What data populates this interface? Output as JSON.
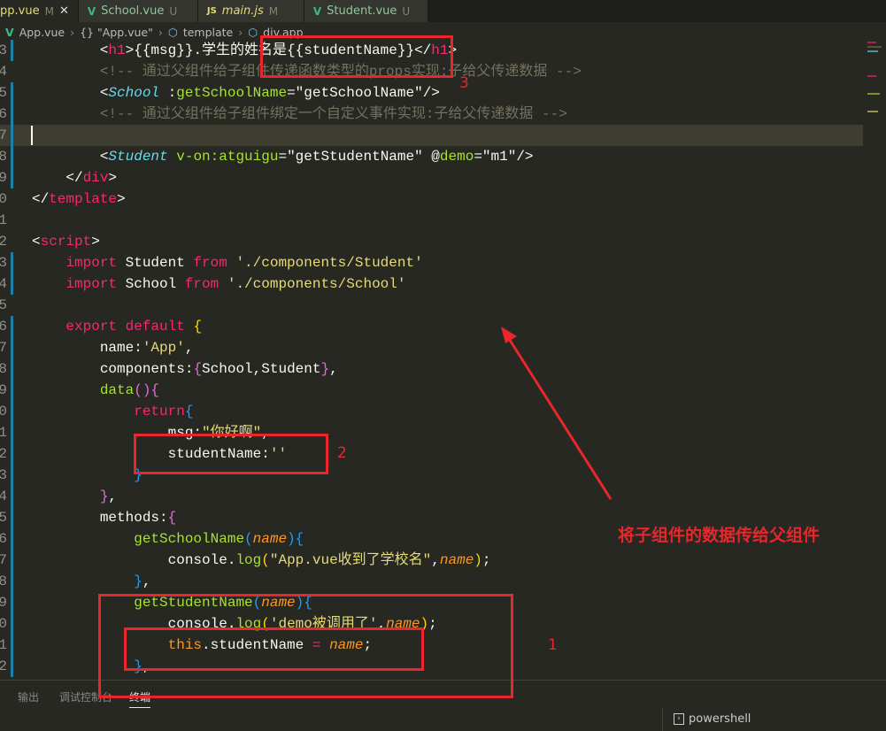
{
  "tabs": [
    {
      "label": "pp.vue",
      "status": "M",
      "icon": "vue-icon",
      "active": true
    },
    {
      "label": "School.vue",
      "status": "U",
      "icon": "vue-icon"
    },
    {
      "label": "main.js",
      "status": "M",
      "icon": "js-icon"
    },
    {
      "label": "Student.vue",
      "status": "U",
      "icon": "vue-icon"
    }
  ],
  "breadcrumb": [
    "App.vue",
    "{} \"App.vue\"",
    "template",
    "div.app"
  ],
  "code": [
    {
      "n": "3",
      "m": true,
      "t": [
        [
          "        ",
          "pun"
        ],
        [
          "<",
          "pun"
        ],
        [
          "h1",
          "tag"
        ],
        [
          ">{{msg}}.学生的姓名是{{studentName}}</",
          "pun"
        ],
        [
          "h1",
          "tag"
        ],
        [
          ">",
          "pun"
        ]
      ]
    },
    {
      "n": "4",
      "t": [
        [
          "        <!-- 通过父组件给子组件传递函数类型的props实现:子给父传递数据 -->",
          "cmt"
        ]
      ]
    },
    {
      "n": "5",
      "m": true,
      "t": [
        [
          "        <",
          "pun"
        ],
        [
          "School",
          "cmp"
        ],
        [
          " :",
          "pun"
        ],
        [
          "getSchoolName",
          "attr"
        ],
        [
          "=\"getSchoolName\"/>",
          "pun"
        ]
      ]
    },
    {
      "n": "6",
      "m": true,
      "t": [
        [
          "        <!-- 通过父组件给子组件绑定一个自定义事件实现:子给父传递数据 -->",
          "cmt"
        ]
      ]
    },
    {
      "n": "7",
      "m": true,
      "cur": true,
      "t": []
    },
    {
      "n": "8",
      "m": true,
      "t": [
        [
          "        <",
          "pun"
        ],
        [
          "Student",
          "cmp"
        ],
        [
          " v-on:",
          "attr"
        ],
        [
          "atguigu",
          "attr"
        ],
        [
          "=\"getStudentName\" @",
          "pun"
        ],
        [
          "demo",
          "attr"
        ],
        [
          "=\"m1\"/>",
          "pun"
        ]
      ]
    },
    {
      "n": "9",
      "m": true,
      "t": [
        [
          "    </",
          "pun"
        ],
        [
          "div",
          "tag"
        ],
        [
          ">",
          "pun"
        ]
      ]
    },
    {
      "n": "0",
      "t": [
        [
          "</",
          "pun"
        ],
        [
          "template",
          "tag"
        ],
        [
          ">",
          "pun"
        ]
      ]
    },
    {
      "n": "1",
      "t": []
    },
    {
      "n": "2",
      "t": [
        [
          "<",
          "pun"
        ],
        [
          "script",
          "tag"
        ],
        [
          ">",
          "pun"
        ]
      ]
    },
    {
      "n": "3",
      "m": true,
      "t": [
        [
          "    ",
          "pun"
        ],
        [
          "import",
          "kw"
        ],
        [
          " Student ",
          "pun"
        ],
        [
          "from",
          "kw"
        ],
        [
          " './components/Student'",
          "str"
        ]
      ]
    },
    {
      "n": "4",
      "m": true,
      "t": [
        [
          "    ",
          "pun"
        ],
        [
          "import",
          "kw"
        ],
        [
          " School ",
          "pun"
        ],
        [
          "from",
          "kw"
        ],
        [
          " './components/School'",
          "str"
        ]
      ]
    },
    {
      "n": "5",
      "t": []
    },
    {
      "n": "6",
      "m": true,
      "t": [
        [
          "    ",
          "pun"
        ],
        [
          "export",
          "kw"
        ],
        [
          " ",
          "pun"
        ],
        [
          "default",
          "kw"
        ],
        [
          " {",
          "b1"
        ]
      ]
    },
    {
      "n": "7",
      "m": true,
      "t": [
        [
          "        name:",
          "pun"
        ],
        [
          "'App'",
          "str"
        ],
        [
          ",",
          "pun"
        ]
      ]
    },
    {
      "n": "8",
      "m": true,
      "t": [
        [
          "        components:",
          "pun"
        ],
        [
          "{",
          "b2"
        ],
        [
          "School,Student",
          "pun"
        ],
        [
          "}",
          "b2"
        ],
        [
          ",",
          "pun"
        ]
      ]
    },
    {
      "n": "9",
      "m": true,
      "t": [
        [
          "        ",
          "pun"
        ],
        [
          "data",
          "fn"
        ],
        [
          "()",
          "b2"
        ],
        [
          "{",
          "b2"
        ]
      ]
    },
    {
      "n": "0",
      "m": true,
      "t": [
        [
          "            ",
          "pun"
        ],
        [
          "return",
          "kw"
        ],
        [
          "{",
          "b3"
        ]
      ]
    },
    {
      "n": "1",
      "m": true,
      "t": [
        [
          "                msg:",
          "pun"
        ],
        [
          "\"你好啊\"",
          "str"
        ],
        [
          ",",
          "pun"
        ]
      ]
    },
    {
      "n": "2",
      "m": true,
      "t": [
        [
          "                studentName:",
          "pun"
        ],
        [
          "''",
          "str"
        ]
      ]
    },
    {
      "n": "3",
      "m": true,
      "t": [
        [
          "            ",
          "pun"
        ],
        [
          "}",
          "b3"
        ]
      ]
    },
    {
      "n": "4",
      "m": true,
      "t": [
        [
          "        ",
          "pun"
        ],
        [
          "}",
          "b2"
        ],
        [
          ",",
          "pun"
        ]
      ]
    },
    {
      "n": "5",
      "m": true,
      "t": [
        [
          "        methods:",
          "pun"
        ],
        [
          "{",
          "b2"
        ]
      ]
    },
    {
      "n": "6",
      "m": true,
      "t": [
        [
          "            ",
          "pun"
        ],
        [
          "getSchoolName",
          "fn"
        ],
        [
          "(",
          "b3"
        ],
        [
          "name",
          "prm"
        ],
        [
          ")",
          "b3"
        ],
        [
          "{",
          "b3"
        ]
      ]
    },
    {
      "n": "7",
      "m": true,
      "t": [
        [
          "                console.",
          "pun"
        ],
        [
          "log",
          "fn"
        ],
        [
          "(",
          "b1"
        ],
        [
          "\"App.vue收到了学校名\"",
          "str"
        ],
        [
          ",",
          "pun"
        ],
        [
          "name",
          "prm"
        ],
        [
          ")",
          "b1"
        ],
        [
          ";",
          "pun"
        ]
      ]
    },
    {
      "n": "8",
      "m": true,
      "t": [
        [
          "            ",
          "pun"
        ],
        [
          "}",
          "b3"
        ],
        [
          ",",
          "pun"
        ]
      ]
    },
    {
      "n": "9",
      "m": true,
      "t": [
        [
          "            ",
          "pun"
        ],
        [
          "getStudentName",
          "fn"
        ],
        [
          "(",
          "b3"
        ],
        [
          "name",
          "prm"
        ],
        [
          ")",
          "b3"
        ],
        [
          "{",
          "b3"
        ]
      ]
    },
    {
      "n": "0",
      "m": true,
      "t": [
        [
          "                console.",
          "pun"
        ],
        [
          "log",
          "fn"
        ],
        [
          "(",
          "b1"
        ],
        [
          "'demo被调用了'",
          "str"
        ],
        [
          ",",
          "pun"
        ],
        [
          "name",
          "prm"
        ],
        [
          ")",
          "b1"
        ],
        [
          ";",
          "pun"
        ]
      ]
    },
    {
      "n": "1",
      "m": true,
      "t": [
        [
          "                ",
          "pun"
        ],
        [
          "this",
          "this"
        ],
        [
          ".studentName ",
          "pun"
        ],
        [
          "=",
          "kw"
        ],
        [
          " ",
          "pun"
        ],
        [
          "name",
          "prm"
        ],
        [
          ";",
          "pun"
        ]
      ]
    },
    {
      "n": "2",
      "m": true,
      "t": [
        [
          "            ",
          "pun"
        ],
        [
          "}",
          "b3"
        ],
        [
          ",",
          "pun"
        ]
      ]
    }
  ],
  "panel": {
    "tabs": [
      "输出",
      "调试控制台",
      "终端"
    ],
    "terminal": "powershell"
  },
  "annotations": {
    "label1": "1",
    "label2": "2",
    "label3": "3",
    "caption": "将子组件的数据传给父组件",
    "color": "#e8262b"
  }
}
